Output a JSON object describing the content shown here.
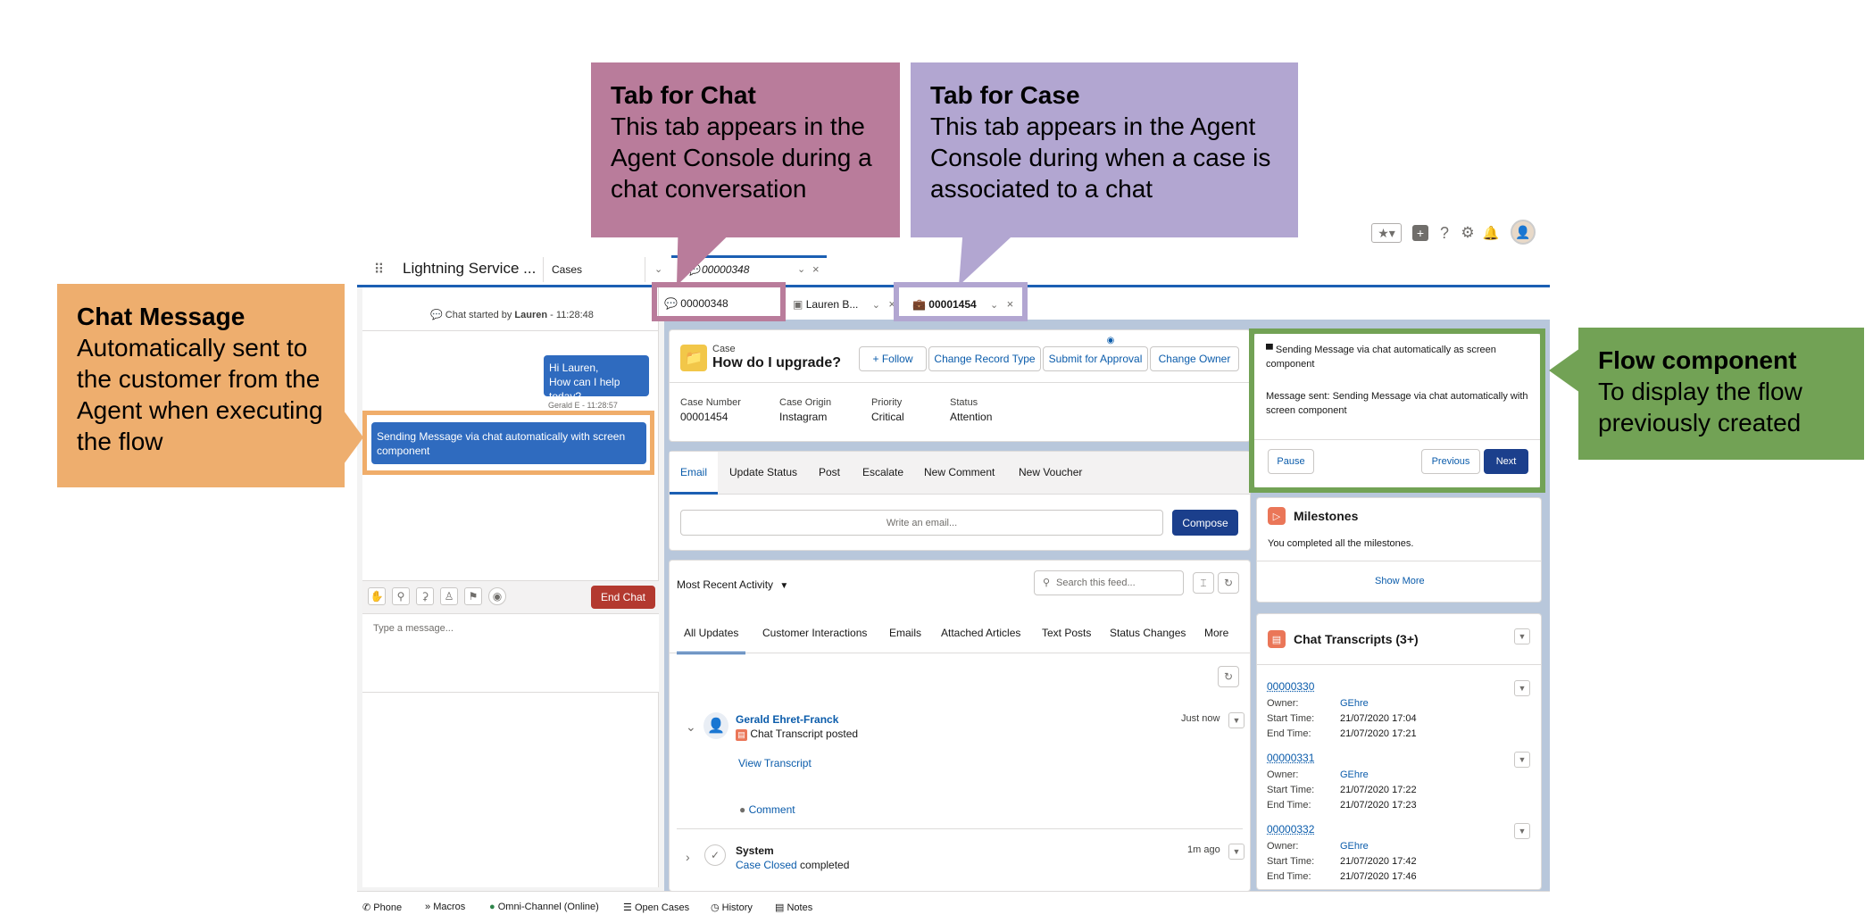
{
  "app": {
    "title": "Lightning Service ...",
    "nav_tab": "Cases",
    "primary_tab": "00000348"
  },
  "subtabs": {
    "chat": "00000348",
    "contact": "Lauren B...",
    "case": "00001454"
  },
  "chat": {
    "started_prefix": "Chat started by",
    "started_name": "Lauren",
    "started_time": "- 11:28:48",
    "agent_msg_1": "Hi Lauren,",
    "agent_msg_2": "How can I help today?",
    "agent_meta": "Gerald E - 11:28:57",
    "flow_msg": "Sending Message via chat automatically with screen component",
    "end_chat": "End Chat",
    "placeholder": "Type a message..."
  },
  "case": {
    "object": "Case",
    "title": "How do I upgrade?",
    "actions": [
      "+ Follow",
      "Change Record Type",
      "Submit for Approval",
      "Change Owner"
    ],
    "fields": [
      {
        "label": "Case Number",
        "value": "00001454"
      },
      {
        "label": "Case Origin",
        "value": "Instagram"
      },
      {
        "label": "Priority",
        "value": "Critical"
      },
      {
        "label": "Status",
        "value": "Attention"
      }
    ]
  },
  "publisher": {
    "tabs": [
      "Email",
      "Update Status",
      "Post",
      "Escalate",
      "New Comment",
      "New Voucher"
    ],
    "placeholder": "Write an email...",
    "compose": "Compose"
  },
  "feed": {
    "sort": "Most Recent Activity",
    "search_placeholder": "Search this feed...",
    "tabs": [
      "All Updates",
      "Customer Interactions",
      "Emails",
      "Attached Articles",
      "Text Posts",
      "Status Changes",
      "More"
    ],
    "item1": {
      "author": "Gerald Ehret-Franck",
      "action": "Chat Transcript posted",
      "time": "Just now",
      "link": "View Transcript",
      "comment": "Comment"
    },
    "item2": {
      "author": "System",
      "link": "Case Closed",
      "action": " completed",
      "time": "1m ago"
    }
  },
  "flow": {
    "line1": "Sending Message via chat automatically as screen component",
    "line2": "Message sent: Sending Message via chat automatically with screen component",
    "pause": "Pause",
    "previous": "Previous",
    "next": "Next"
  },
  "milestones": {
    "title": "Milestones",
    "text": "You completed all the milestones.",
    "show_more": "Show More"
  },
  "transcripts": {
    "title": "Chat Transcripts (3+)",
    "labels": {
      "owner": "Owner:",
      "start": "Start Time:",
      "end": "End Time:"
    },
    "items": [
      {
        "id": "00000330",
        "owner": "GEhre",
        "start": "21/07/2020 17:04",
        "end": "21/07/2020 17:21"
      },
      {
        "id": "00000331",
        "owner": "GEhre",
        "start": "21/07/2020 17:22",
        "end": "21/07/2020 17:23"
      },
      {
        "id": "00000332",
        "owner": "GEhre",
        "start": "21/07/2020 17:42",
        "end": "21/07/2020 17:46"
      }
    ]
  },
  "utility": [
    "Phone",
    "Macros",
    "Omni-Channel (Online)",
    "Open Cases",
    "History",
    "Notes"
  ],
  "callouts": {
    "chat_tab": {
      "title": "Tab for Chat",
      "body": "This tab appears in the Agent Console during a chat conversation"
    },
    "case_tab": {
      "title": "Tab for Case",
      "body": "This tab appears in the Agent Console during when a case is associated to a chat"
    },
    "chat_message": {
      "title": "Chat Message",
      "body": "Automatically sent to the customer from the Agent when executing the flow"
    },
    "flow_component": {
      "title": "Flow component",
      "body": "To display the flow previously created"
    }
  },
  "colors": {
    "chat_callout": "#b97c9b",
    "case_callout": "#b2a6d1",
    "message_callout": "#eeae6e",
    "flow_callout": "#72a255",
    "brand": "#1b5fb3"
  }
}
